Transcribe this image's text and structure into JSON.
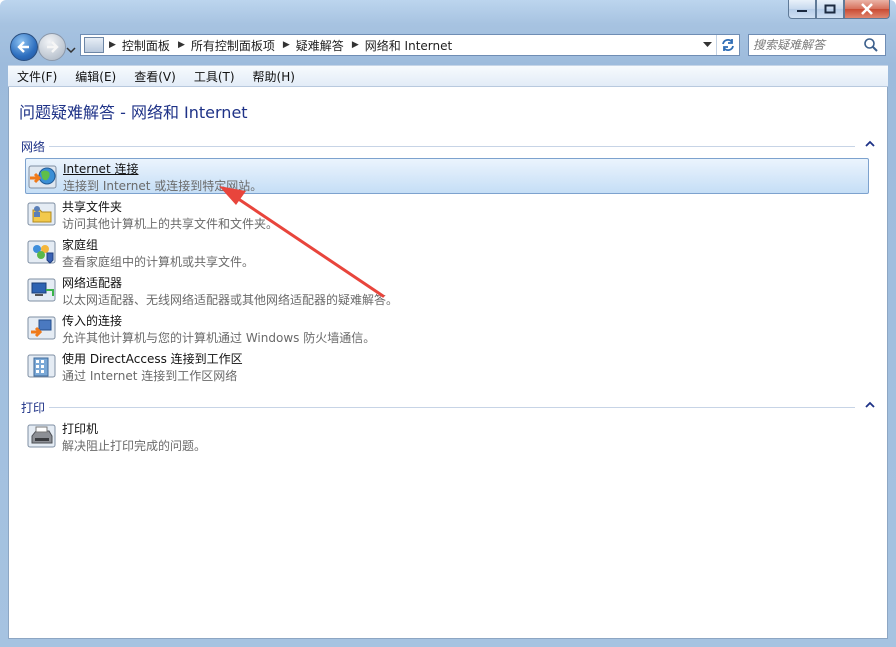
{
  "breadcrumbs": [
    "控制面板",
    "所有控制面板项",
    "疑难解答",
    "网络和 Internet"
  ],
  "search": {
    "placeholder": "搜索疑难解答"
  },
  "menu": [
    "文件(F)",
    "编辑(E)",
    "查看(V)",
    "工具(T)",
    "帮助(H)"
  ],
  "page_title": "问题疑难解答 - 网络和 Internet",
  "groups": [
    {
      "name": "网络",
      "items": [
        {
          "title": "Internet 连接",
          "desc": "连接到 Internet 或连接到特定网站。",
          "icon": "internet-globe-icon",
          "selected": true
        },
        {
          "title": "共享文件夹",
          "desc": "访问其他计算机上的共享文件和文件夹。",
          "icon": "shared-folder-icon"
        },
        {
          "title": "家庭组",
          "desc": "查看家庭组中的计算机或共享文件。",
          "icon": "homegroup-icon"
        },
        {
          "title": "网络适配器",
          "desc": "以太网适配器、无线网络适配器或其他网络适配器的疑难解答。",
          "icon": "network-adapter-icon"
        },
        {
          "title": "传入的连接",
          "desc": "允许其他计算机与您的计算机通过 Windows 防火墙通信。",
          "icon": "incoming-connection-icon"
        },
        {
          "title": "使用 DirectAccess 连接到工作区",
          "desc": "通过 Internet 连接到工作区网络",
          "icon": "directaccess-icon"
        }
      ]
    },
    {
      "name": "打印",
      "items": [
        {
          "title": "打印机",
          "desc": "解决阻止打印完成的问题。",
          "icon": "printer-icon"
        }
      ]
    }
  ],
  "colors": {
    "title_blue": "#1e3287",
    "annotation_arrow": "#e8453c",
    "selection_border": "#7da2ce"
  }
}
